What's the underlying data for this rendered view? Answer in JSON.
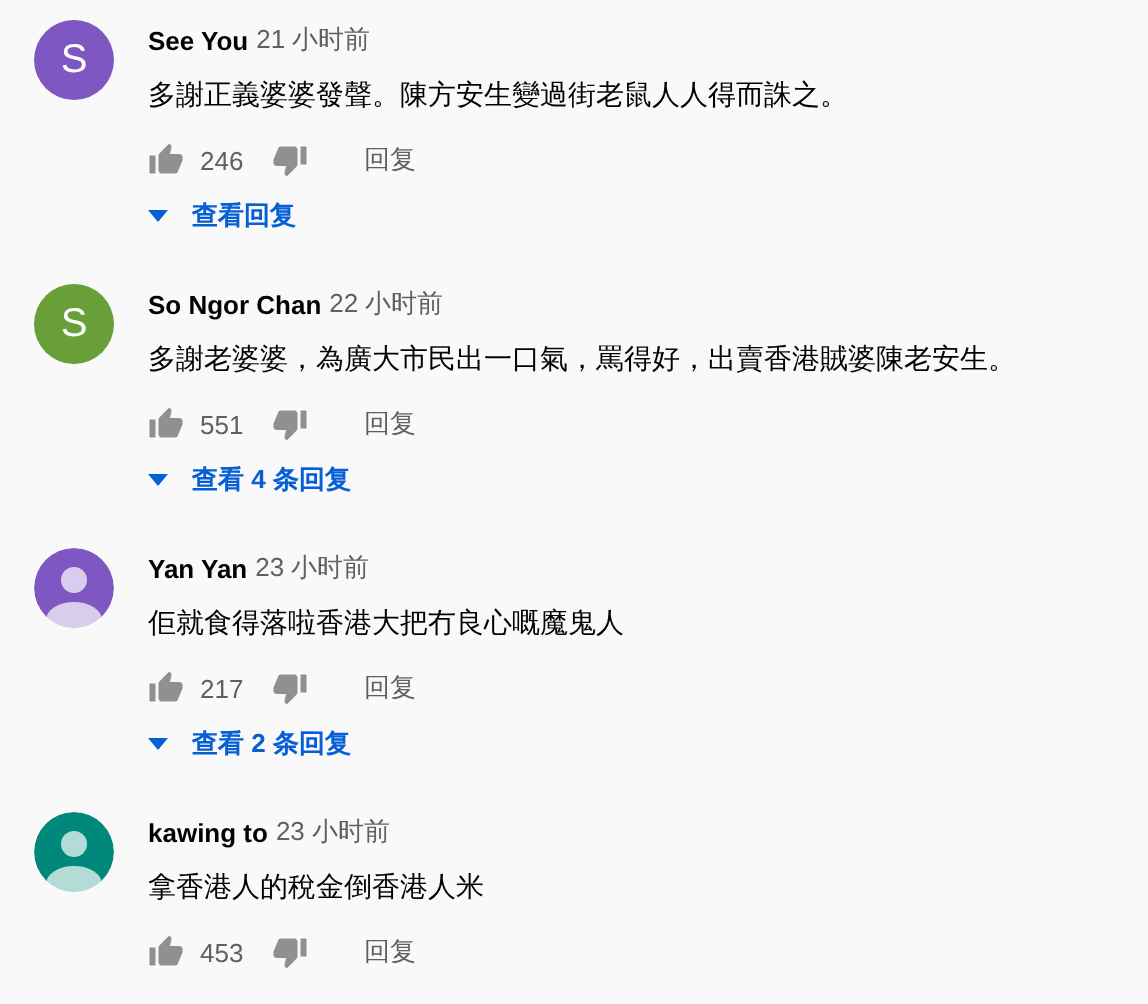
{
  "comments": [
    {
      "avatar": {
        "kind": "letter",
        "letter": "S",
        "color": "#7e57c2"
      },
      "author": "See You",
      "time": "21 小时前",
      "text": "多謝正義婆婆發聲。陳方安生變過街老鼠人人得而誅之。",
      "likes": "246",
      "reply": "回复",
      "view_replies": "查看回复"
    },
    {
      "avatar": {
        "kind": "letter",
        "letter": "S",
        "color": "#689f38"
      },
      "author": "So Ngor Chan",
      "time": "22 小时前",
      "text": "多謝老婆婆，為廣大市民出一口氣，罵得好，出賣香港賊婆陳老安生。",
      "likes": "551",
      "reply": "回复",
      "view_replies": "查看 4 条回复"
    },
    {
      "avatar": {
        "kind": "silhouette",
        "color": "#7e57c2"
      },
      "author": "Yan Yan",
      "time": "23 小时前",
      "text": "佢就食得落啦香港大把冇良心嘅魔鬼人",
      "likes": "217",
      "reply": "回复",
      "view_replies": "查看 2 条回复"
    },
    {
      "avatar": {
        "kind": "silhouette",
        "color": "#00897b"
      },
      "author": "kawing to",
      "time": "23 小时前",
      "text": "拿香港人的稅金倒香港人米",
      "likes": "453",
      "reply": "回复"
    }
  ]
}
